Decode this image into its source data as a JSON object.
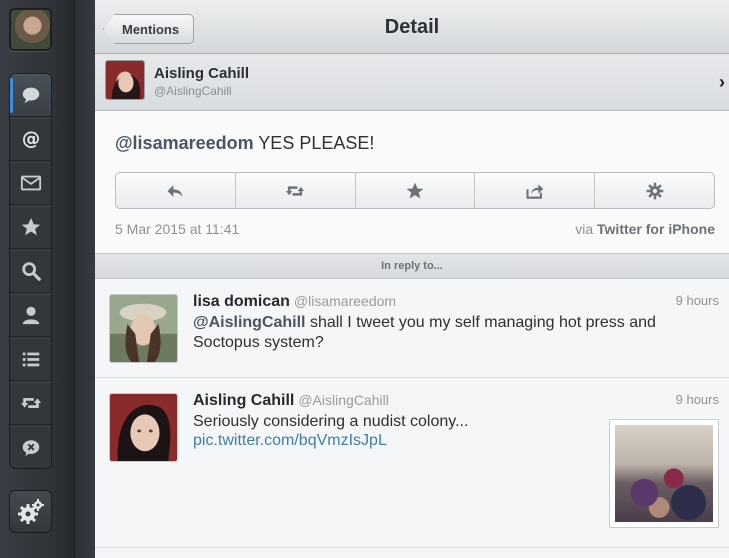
{
  "colors": {
    "accent": "#3b8fdc",
    "link": "#3e7fa7",
    "mention": "#4a5663"
  },
  "sidebar": {
    "items": [
      {
        "icon": "speech-bubble-icon",
        "active": true
      },
      {
        "icon": "at-sign-icon",
        "active": false
      },
      {
        "icon": "envelope-icon",
        "active": false
      },
      {
        "icon": "star-icon",
        "active": false
      },
      {
        "icon": "search-icon",
        "active": false
      },
      {
        "icon": "person-icon",
        "active": false
      },
      {
        "icon": "list-icon",
        "active": false
      },
      {
        "icon": "retweet-icon",
        "active": false
      },
      {
        "icon": "blocked-bubble-icon",
        "active": false
      }
    ],
    "settings_icon": "gears-icon"
  },
  "header": {
    "back_label": "Mentions",
    "title": "Detail"
  },
  "author": {
    "name": "Aisling Cahill",
    "handle": "@AislingCahill"
  },
  "tweet": {
    "mention": "@lisamareedom",
    "text": " YES PLEASE!",
    "timestamp": "5 Mar 2015 at 11:41",
    "via_prefix": "via ",
    "via_client": "Twitter for iPhone",
    "actions": [
      "reply-icon",
      "retweet-icon",
      "favorite-star-icon",
      "share-icon",
      "gear-icon"
    ]
  },
  "reply_label": "In reply to...",
  "replies": [
    {
      "name": "lisa domican",
      "handle": "@lisamareedom",
      "time": "9 hours",
      "mention": "@AislingCahill",
      "text": " shall I tweet you my self managing hot press and Soctopus system?"
    },
    {
      "name": "Aisling Cahill",
      "handle": "@AislingCahill",
      "time": "9 hours",
      "text": "Seriously considering a nudist colony...",
      "link": "pic.twitter.com/bqVmzIsJpL"
    }
  ]
}
